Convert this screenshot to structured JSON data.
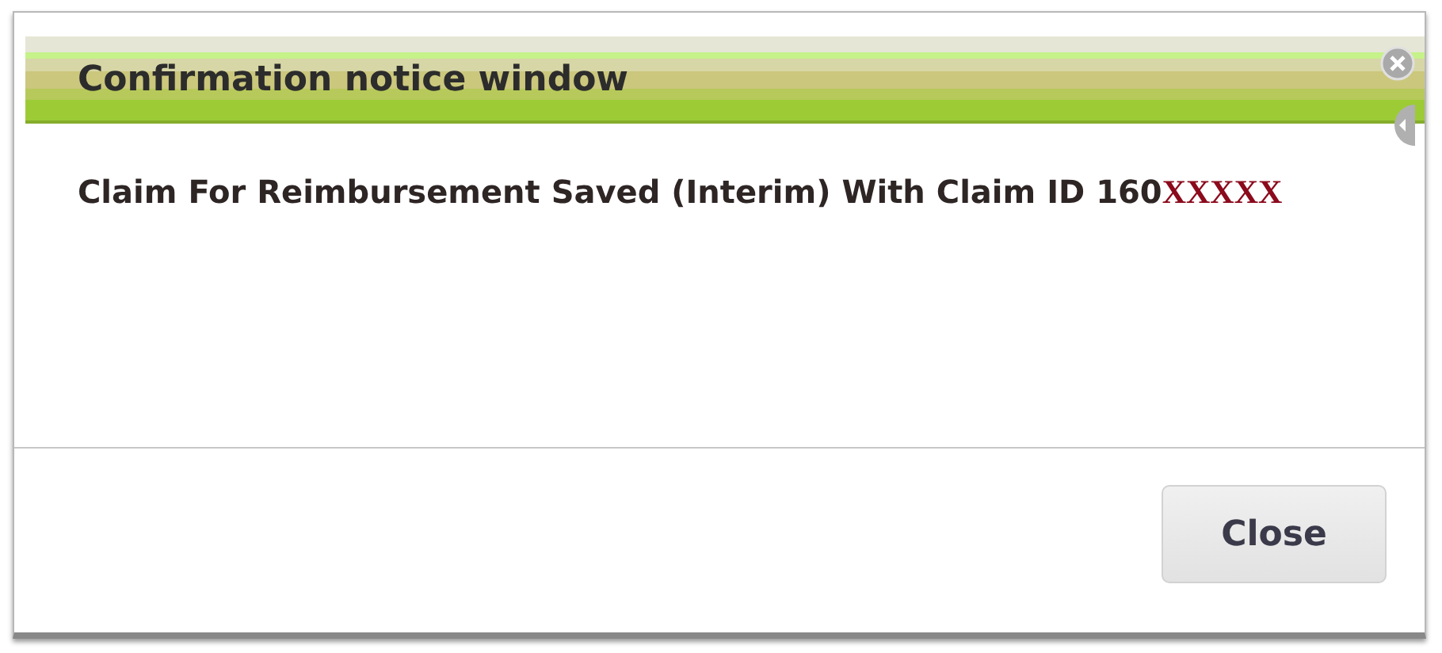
{
  "window": {
    "title": "Confirmation notice window"
  },
  "message": {
    "text": "Claim For Reimbursement Saved (Interim) With Claim ID 160",
    "redacted": "XXXXX"
  },
  "buttons": [
    {
      "label": "Close"
    }
  ]
}
